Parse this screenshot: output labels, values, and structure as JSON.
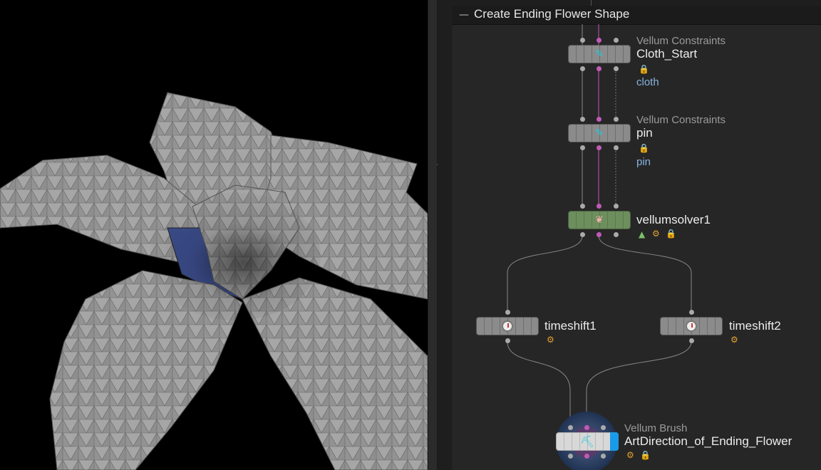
{
  "viewport": {
    "label": "3D viewport - flower mesh"
  },
  "network": {
    "title": "Create Ending Flower Shape",
    "collapse_glyph": "—",
    "nodes": [
      {
        "type_label": "Vellum Constraints",
        "name": "Cloth_Start",
        "group": "cloth"
      },
      {
        "type_label": "Vellum Constraints",
        "name": "pin",
        "group": "pin"
      },
      {
        "type_label": "",
        "name": "vellumsolver1",
        "group": ""
      },
      {
        "type_label": "",
        "name": "timeshift1",
        "group": ""
      },
      {
        "type_label": "",
        "name": "timeshift2",
        "group": ""
      },
      {
        "type_label": "Vellum Brush",
        "name": "ArtDirection_of_Ending_Flower",
        "group": ""
      }
    ]
  },
  "icons": {
    "constraint_icon": "pin-icon",
    "solver_icon": "vellum-solver-icon",
    "timeshift_icon": "clock-icon",
    "brush_icon": "brush-icon",
    "lock_icon": "lock-icon",
    "gear_icon": "gear-icon",
    "render_icon": "render-flag-icon"
  },
  "colors": {
    "node_gray": "#8b8b8b",
    "solver_green": "#6d8e5d",
    "wire_pink": "#c05ab8",
    "group_blue": "#86b4e0",
    "display_flag_blue": "#1a9be8",
    "background": "#262626"
  }
}
